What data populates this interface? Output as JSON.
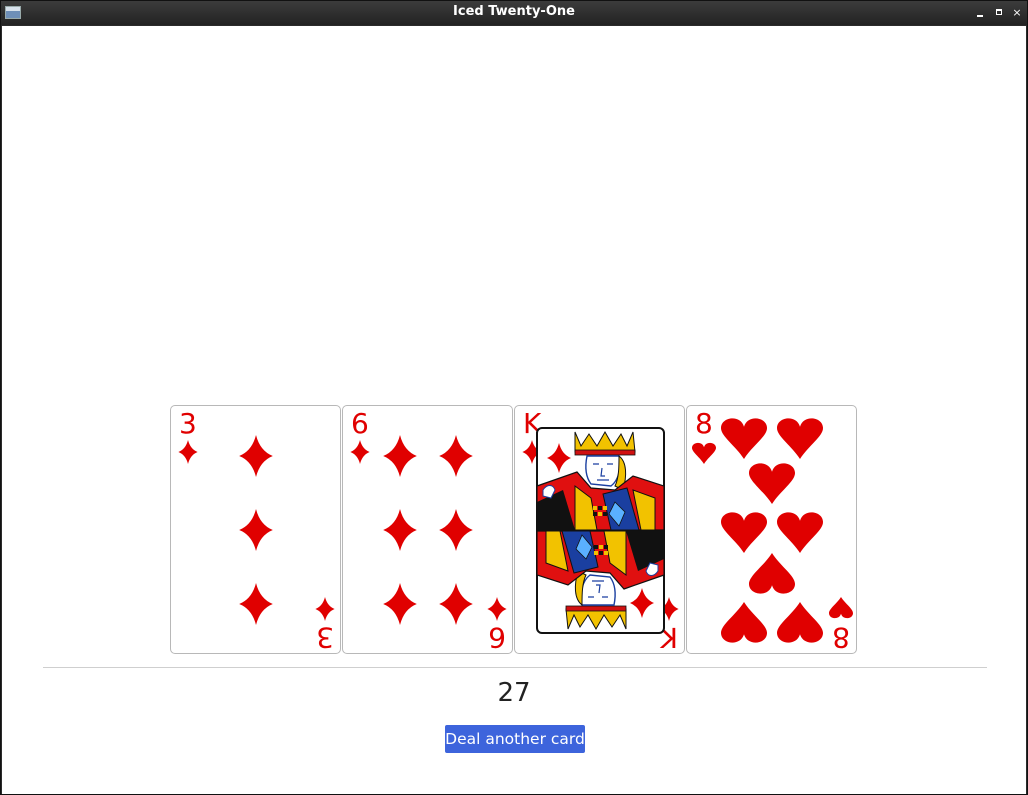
{
  "window": {
    "title": "Iced Twenty-One"
  },
  "hand": {
    "cards": [
      {
        "rank": "3",
        "suit": "diamonds",
        "color": "#e00000"
      },
      {
        "rank": "6",
        "suit": "diamonds",
        "color": "#e00000"
      },
      {
        "rank": "K",
        "suit": "diamonds",
        "color": "#e00000"
      },
      {
        "rank": "8",
        "suit": "hearts",
        "color": "#e00000"
      }
    ]
  },
  "score": "27",
  "actions": {
    "deal_label": "Deal another card"
  },
  "colors": {
    "button": "#3d64dc",
    "suit_red": "#e00000"
  }
}
